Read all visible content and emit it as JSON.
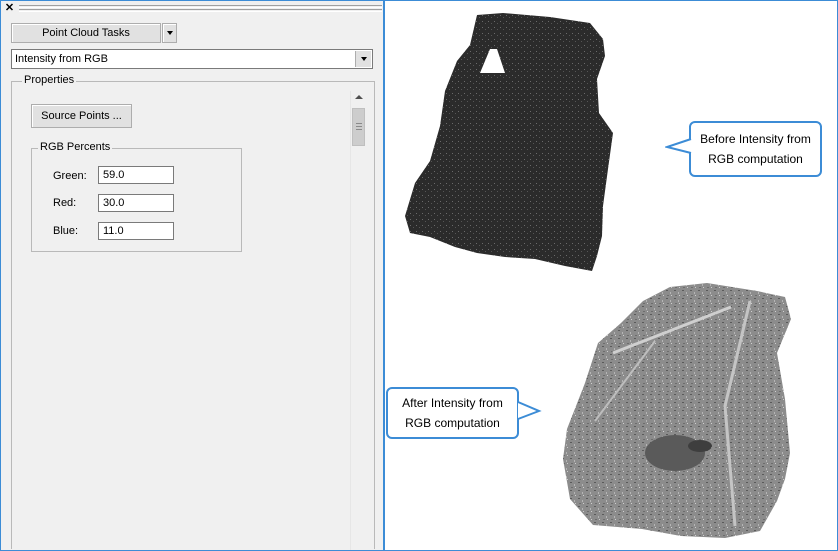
{
  "panel": {
    "close_glyph": "✕",
    "tasks_button": "Point Cloud Tasks",
    "task_select_value": "Intensity from RGB",
    "properties_label": "Properties",
    "source_points_button": "Source Points ...",
    "rgb_group_label": "RGB Percents",
    "fields": [
      {
        "label": "Green:",
        "value": "59.0"
      },
      {
        "label": "Red:",
        "value": "30.0"
      },
      {
        "label": "Blue:",
        "value": "11.0"
      }
    ]
  },
  "view": {
    "callout_before": [
      "Before Intensity from",
      "RGB computation"
    ],
    "callout_after": [
      "After Intensity from",
      "RGB computation"
    ]
  },
  "colors": {
    "accent": "#3c8cd6",
    "cloud_before": "#2b2b2b",
    "cloud_after": "#8a8a8a"
  }
}
